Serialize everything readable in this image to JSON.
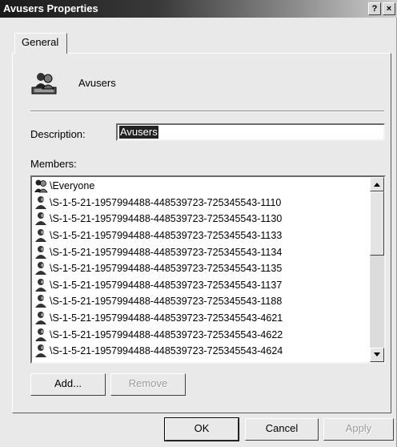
{
  "window": {
    "title": "Avusers Properties",
    "help_label": "?",
    "close_label": "×"
  },
  "tabs": [
    {
      "label": "General"
    }
  ],
  "general": {
    "group_name": "Avusers",
    "description_label": "Description:",
    "description_value": "Avusers",
    "members_label": "Members:"
  },
  "members": [
    {
      "name": "\\Everyone",
      "icon": "group-icon"
    },
    {
      "name": "\\S-1-5-21-1957994488-448539723-725345543-1110",
      "icon": "user-icon"
    },
    {
      "name": "\\S-1-5-21-1957994488-448539723-725345543-1130",
      "icon": "user-icon"
    },
    {
      "name": "\\S-1-5-21-1957994488-448539723-725345543-1133",
      "icon": "user-icon"
    },
    {
      "name": "\\S-1-5-21-1957994488-448539723-725345543-1134",
      "icon": "user-icon"
    },
    {
      "name": "\\S-1-5-21-1957994488-448539723-725345543-1135",
      "icon": "user-icon"
    },
    {
      "name": "\\S-1-5-21-1957994488-448539723-725345543-1137",
      "icon": "user-icon"
    },
    {
      "name": "\\S-1-5-21-1957994488-448539723-725345543-1188",
      "icon": "user-icon"
    },
    {
      "name": "\\S-1-5-21-1957994488-448539723-725345543-4621",
      "icon": "user-icon"
    },
    {
      "name": "\\S-1-5-21-1957994488-448539723-725345543-4622",
      "icon": "user-icon"
    },
    {
      "name": "\\S-1-5-21-1957994488-448539723-725345543-4624",
      "icon": "user-icon"
    }
  ],
  "buttons": {
    "add": "Add...",
    "remove": "Remove",
    "ok": "OK",
    "cancel": "Cancel",
    "apply": "Apply"
  }
}
